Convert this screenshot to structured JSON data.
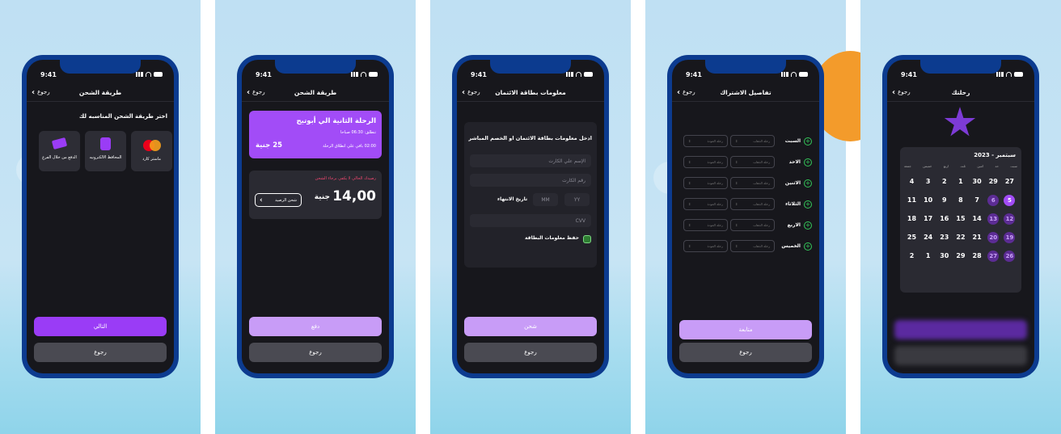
{
  "status": {
    "time": "9:41"
  },
  "screens": {
    "s1": {
      "back": "رجوع",
      "title": "طريقة الشحن",
      "heading": "اختر طريقة الشحن المناسبه لك",
      "options": [
        "ماستر كارد",
        "المحافظ الالكترونيه",
        "الدفع من خلال الفرع"
      ],
      "next": "التالي",
      "back_btn": "رجوع"
    },
    "s2": {
      "back": "رجوع",
      "title": "طريقة الشحن",
      "trip_title": "الرحلة الثانية الي أبوتيج",
      "depart": "تنطلق: 06:30 صباحا",
      "remaining": "02:00 باقي علي انطلاق الرحلة",
      "price": "25 جنية",
      "warning": "رصيدك الحالي لا يكفي برجاء الشحن",
      "balance_value": "14,00",
      "balance_unit": "جنية",
      "charge_btn": "شحن الرصيد",
      "pay": "دفع",
      "back_btn": "رجوع"
    },
    "s3": {
      "back": "رجوع",
      "title": "معلومات بطاقة الائتمان",
      "heading": "ادخل معلومات بطاقة الائتمان او الخصم المباشر",
      "name_ph": "الإسم علي الكارت",
      "card_ph": "رقم الكارت",
      "expiry": "تاريخ الانتهاء",
      "mm": "MM",
      "yy": "YY",
      "cvv": "CVV",
      "save": "حفظ معلومات البطاقة",
      "charge": "شحن",
      "back_btn": "رجوع"
    },
    "s4": {
      "back": "رجوع",
      "title": "تفاصيل الاشتراك",
      "days": [
        "السبت",
        "الاحد",
        "الاثنين",
        "الثلاثاء",
        "الاربع",
        "الخميس"
      ],
      "go": "رحلة الذهاب",
      "ret": "رحلة العودة",
      "continue": "متابعة",
      "back_btn": "رجوع"
    },
    "s5": {
      "back": "رجوع",
      "title": "رحلتك",
      "month": "2023 - سبتمبر",
      "weekdays": [
        "سبت",
        "حد",
        "اثنين",
        "ثلث",
        "اربع",
        "خميس",
        "جمعة"
      ],
      "rows": [
        [
          "27",
          "29",
          "30",
          "1",
          "2",
          "3",
          "4"
        ],
        [
          "5",
          "6",
          "7",
          "8",
          "9",
          "10",
          "11"
        ],
        [
          "12",
          "13",
          "14",
          "15",
          "16",
          "17",
          "18"
        ],
        [
          "19",
          "20",
          "21",
          "22",
          "23",
          "24",
          "25"
        ],
        [
          "26",
          "27",
          "28",
          "29",
          "30",
          "1",
          "2"
        ]
      ]
    }
  }
}
